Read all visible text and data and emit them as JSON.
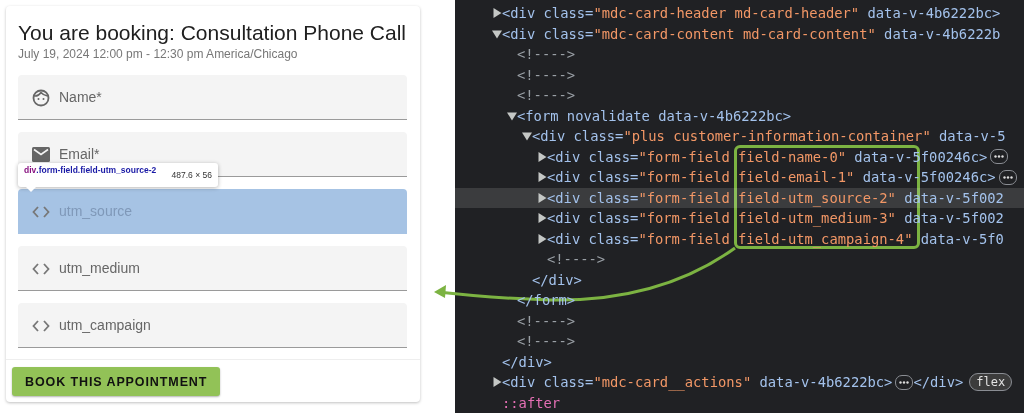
{
  "booking": {
    "title": "You are booking: Consultation Phone Call",
    "subtitle": "July 19, 2024 12:00 pm - 12:30 pm America/Chicago",
    "fields": [
      {
        "kind": "person",
        "placeholder": "Name*",
        "highlighted": false
      },
      {
        "kind": "email",
        "placeholder": "Email*",
        "highlighted": false
      },
      {
        "kind": "custom",
        "placeholder": "utm_source",
        "highlighted": true
      },
      {
        "kind": "custom",
        "placeholder": "utm_medium",
        "highlighted": false
      },
      {
        "kind": "custom",
        "placeholder": "utm_campaign",
        "highlighted": false
      }
    ],
    "button": "BOOK THIS APPOINTMENT",
    "tooltip": {
      "tag": "div",
      "selector": ".form-field.field-utm_source-2",
      "size": "487.6 × 56"
    }
  },
  "devtools": {
    "nodes": [
      {
        "expanded": false,
        "selected": false,
        "tokens": [
          {
            "kind": "markup",
            "text": "<div class="
          },
          {
            "kind": "value",
            "text": "\"mdc-card-header md-card-header\""
          },
          {
            "kind": "markup",
            "text": " data-v-4b6222bc>"
          }
        ]
      },
      {
        "expanded": true,
        "selected": false,
        "tokens": [
          {
            "kind": "markup",
            "text": "<div class="
          },
          {
            "kind": "value",
            "text": "\"mdc-card-content md-card-content\""
          },
          {
            "kind": "markup",
            "text": " data-v-4b6222b"
          }
        ],
        "close": "</div>",
        "children": [
          {
            "selected": false,
            "tokens": [
              {
                "kind": "comment",
                "text": "<!---->"
              }
            ]
          },
          {
            "selected": false,
            "tokens": [
              {
                "kind": "comment",
                "text": "<!---->"
              }
            ]
          },
          {
            "selected": false,
            "tokens": [
              {
                "kind": "comment",
                "text": "<!---->"
              }
            ]
          },
          {
            "expanded": true,
            "selected": false,
            "tokens": [
              {
                "kind": "markup",
                "text": "<form novalidate data-v-4b6222bc>"
              }
            ],
            "close": "</form>",
            "children": [
              {
                "expanded": true,
                "selected": false,
                "tokens": [
                  {
                    "kind": "markup",
                    "text": "<div class="
                  },
                  {
                    "kind": "value",
                    "text": "\"plus customer-information-container\""
                  },
                  {
                    "kind": "markup",
                    "text": " data-v-5"
                  }
                ],
                "close": "</div>",
                "children": [
                  {
                    "expanded": false,
                    "selected": false,
                    "ellipsis": true,
                    "tokens": [
                      {
                        "kind": "markup",
                        "text": "<div class="
                      },
                      {
                        "kind": "value",
                        "text": "\"form-field field-name-0\""
                      },
                      {
                        "kind": "markup",
                        "text": " data-v-5f00246c>"
                      }
                    ]
                  },
                  {
                    "expanded": false,
                    "selected": false,
                    "ellipsis": true,
                    "tokens": [
                      {
                        "kind": "markup",
                        "text": "<div class="
                      },
                      {
                        "kind": "value",
                        "text": "\"form-field field-email-1\""
                      },
                      {
                        "kind": "markup",
                        "text": " data-v-5f00246c>"
                      }
                    ]
                  },
                  {
                    "expanded": false,
                    "selected": true,
                    "tokens": [
                      {
                        "kind": "markup",
                        "text": "<div class="
                      },
                      {
                        "kind": "value",
                        "text": "\"form-field field-utm_source-2\""
                      },
                      {
                        "kind": "markup",
                        "text": " data-v-5f002"
                      }
                    ]
                  },
                  {
                    "expanded": false,
                    "selected": false,
                    "tokens": [
                      {
                        "kind": "markup",
                        "text": "<div class="
                      },
                      {
                        "kind": "value",
                        "text": "\"form-field field-utm_medium-3\""
                      },
                      {
                        "kind": "markup",
                        "text": " data-v-5f002"
                      }
                    ]
                  },
                  {
                    "expanded": false,
                    "selected": false,
                    "tokens": [
                      {
                        "kind": "markup",
                        "text": "<div class="
                      },
                      {
                        "kind": "value",
                        "text": "\"form-field field-utm_campaign-4\""
                      },
                      {
                        "kind": "markup",
                        "text": " data-v-5f0"
                      }
                    ]
                  },
                  {
                    "selected": false,
                    "tokens": [
                      {
                        "kind": "comment",
                        "text": "<!---->"
                      }
                    ]
                  }
                ]
              }
            ]
          },
          {
            "selected": false,
            "tokens": [
              {
                "kind": "comment",
                "text": "<!---->"
              }
            ]
          },
          {
            "selected": false,
            "tokens": [
              {
                "kind": "comment",
                "text": "<!---->"
              }
            ]
          }
        ]
      },
      {
        "expanded": false,
        "selected": false,
        "ellipsis": true,
        "tokens": [
          {
            "kind": "markup",
            "text": "<div class="
          },
          {
            "kind": "value",
            "text": "\"mdc-card__actions\""
          },
          {
            "kind": "markup",
            "text": " data-v-4b6222bc>"
          }
        ],
        "after": "</div>",
        "tag_badge": "flex"
      },
      {
        "selected": false,
        "tokens": [
          {
            "kind": "pseudo",
            "text": "::after"
          }
        ]
      }
    ]
  }
}
